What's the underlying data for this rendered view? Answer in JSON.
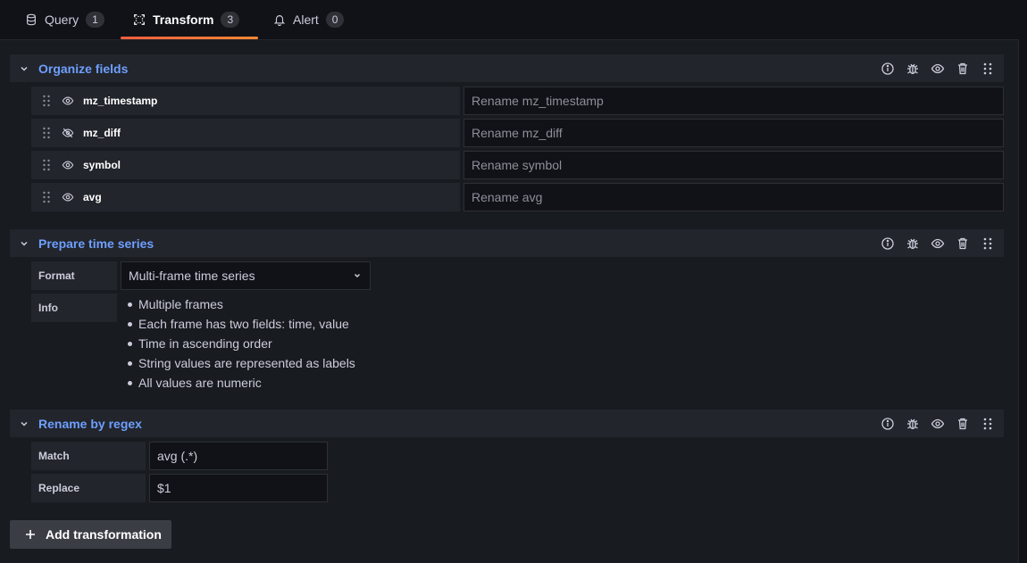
{
  "tabs": [
    {
      "label": "Query",
      "count": "1",
      "icon": "database-icon"
    },
    {
      "label": "Transform",
      "count": "3",
      "icon": "transform-icon",
      "active": true
    },
    {
      "label": "Alert",
      "count": "0",
      "icon": "bell-icon"
    }
  ],
  "organize": {
    "title": "Organize fields",
    "fields": [
      {
        "name": "mz_timestamp",
        "visible": true,
        "placeholder": "Rename mz_timestamp"
      },
      {
        "name": "mz_diff",
        "visible": false,
        "placeholder": "Rename mz_diff"
      },
      {
        "name": "symbol",
        "visible": true,
        "placeholder": "Rename symbol"
      },
      {
        "name": "avg",
        "visible": true,
        "placeholder": "Rename avg"
      }
    ]
  },
  "prepare": {
    "title": "Prepare time series",
    "format_label": "Format",
    "format_value": "Multi-frame time series",
    "info_label": "Info",
    "info_items": [
      "Multiple frames",
      "Each frame has two fields: time, value",
      "Time in ascending order",
      "String values are represented as labels",
      "All values are numeric"
    ]
  },
  "regex": {
    "title": "Rename by regex",
    "match_label": "Match",
    "match_value": "avg (.*)",
    "replace_label": "Replace",
    "replace_value": "$1"
  },
  "add_button": {
    "label": "Add transformation"
  },
  "colors": {
    "accent": "#6e9fff",
    "tab_underline": "#ff8833",
    "panel": "#181b1f",
    "header": "#22252b"
  }
}
